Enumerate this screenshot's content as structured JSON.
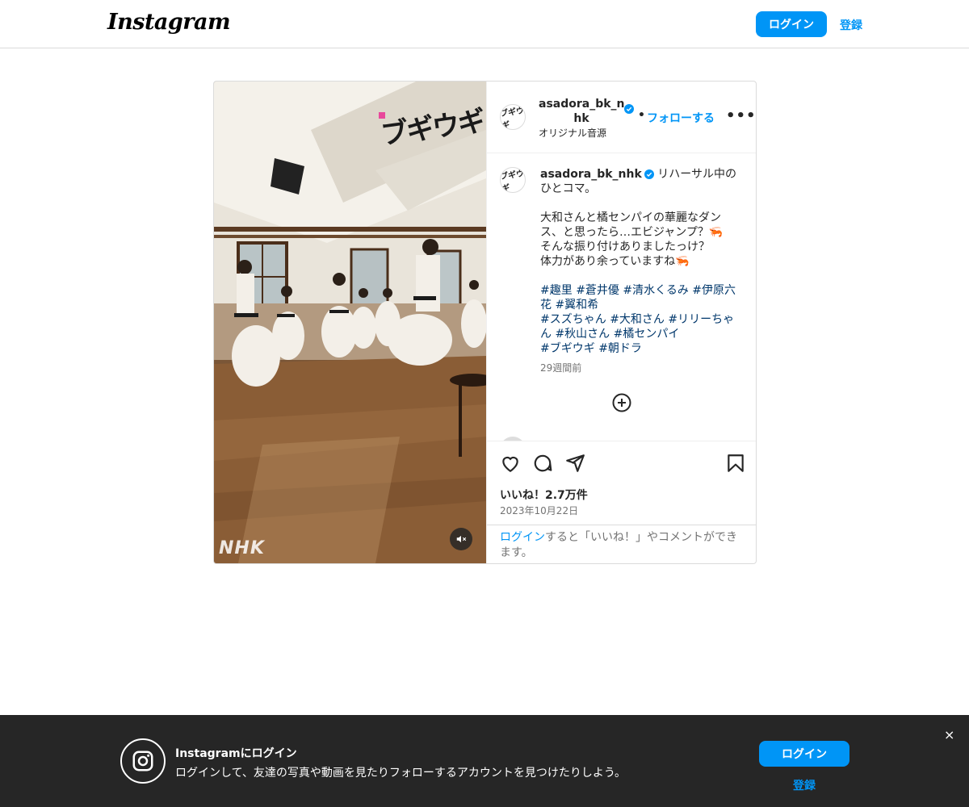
{
  "brand": {
    "logo_text": "Instagram"
  },
  "topbar": {
    "login_label": "ログイン",
    "signup_label": "登録"
  },
  "post": {
    "media": {
      "overlay_logo_text": "ブギウギ",
      "watermark": "NHK",
      "mute_icon": "volume-muted-icon"
    },
    "header": {
      "username": "asadora_bk_nhk",
      "username_wrapped": "asadora_bk_n hk",
      "avatar_text": "ブギウギ",
      "separator": "•",
      "follow_label": "フォローする",
      "audio_label": "オリジナル音源",
      "more_icon": "more-horizontal-icon"
    },
    "caption": {
      "username": "asadora_bk_nhk",
      "first_line": " リハーサル中のひとコマ。",
      "body": "\n\n大和さんと橘センパイの華麗なダンス、と思ったら…エビジャンプ？🦐\nそんな振り付けありましたっけ？\n体力があり余っていますね🦐\n\n",
      "hashtags_line1": [
        "#趣里",
        "#蒼井優",
        "#清水くるみ",
        "#伊原六花",
        "#翼和希"
      ],
      "hashtags_line2": [
        "#スズちゃん",
        "#大和さん",
        "#リリーちゃん",
        "#秋山さん",
        "#橘センパイ"
      ],
      "hashtags_line3": [
        "#ブギウギ",
        "#朝ドラ"
      ],
      "time_ago": "29週間前"
    },
    "actions": {
      "like_icon": "heart-icon",
      "comment_icon": "comment-icon",
      "share_icon": "send-icon",
      "save_icon": "bookmark-icon",
      "add_comment_icon": "plus-circle-icon"
    },
    "likes_text": "いいね！2.7万件",
    "date_text": "2023年10月22日",
    "login_prompt": {
      "link": "ログイン",
      "rest": "すると「いいね！」やコメントができます。"
    }
  },
  "banner": {
    "icon": "instagram-icon",
    "title": "Instagramにログイン",
    "subtitle": "ログインして、友達の写真や動画を見たりフォローするアカウントを見つけたりしよう。",
    "login_label": "ログイン",
    "signup_label": "登録",
    "close_label": "×"
  },
  "colors": {
    "accent": "#0095f6",
    "banner_bg": "#262626",
    "hashtag": "#00376b",
    "muted": "#737373"
  }
}
